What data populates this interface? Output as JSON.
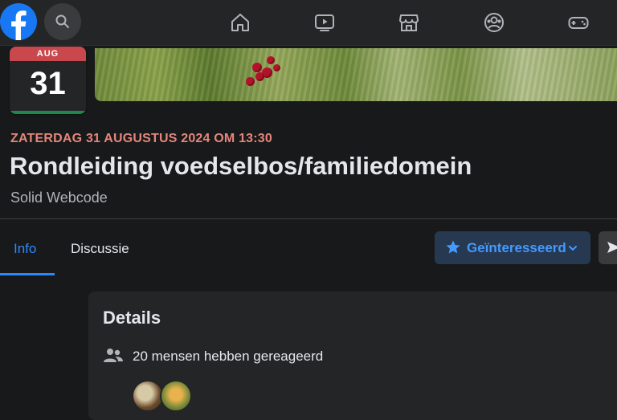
{
  "nav": {
    "logo_icon": "facebook-logo-icon",
    "icons": [
      "home-icon",
      "video-icon",
      "marketplace-icon",
      "groups-icon",
      "gaming-icon"
    ]
  },
  "event": {
    "tile_month": "AUG",
    "tile_day": "31",
    "date_line": "ZATERDAG 31 AUGUSTUS 2024 OM 13:30",
    "title": "Rondleiding voedselbos/familiedomein",
    "host": "Solid Webcode"
  },
  "tabs": [
    {
      "label": "Info",
      "active": true
    },
    {
      "label": "Discussie",
      "active": false
    }
  ],
  "actions": {
    "interested_label": "Geïnteresseerd"
  },
  "details": {
    "title": "Details",
    "reacted_text": "20 mensen hebben gereageerd"
  },
  "colors": {
    "accent": "#2d88ff",
    "background": "#18191a",
    "card": "#242526",
    "date_text": "#e4867b"
  }
}
